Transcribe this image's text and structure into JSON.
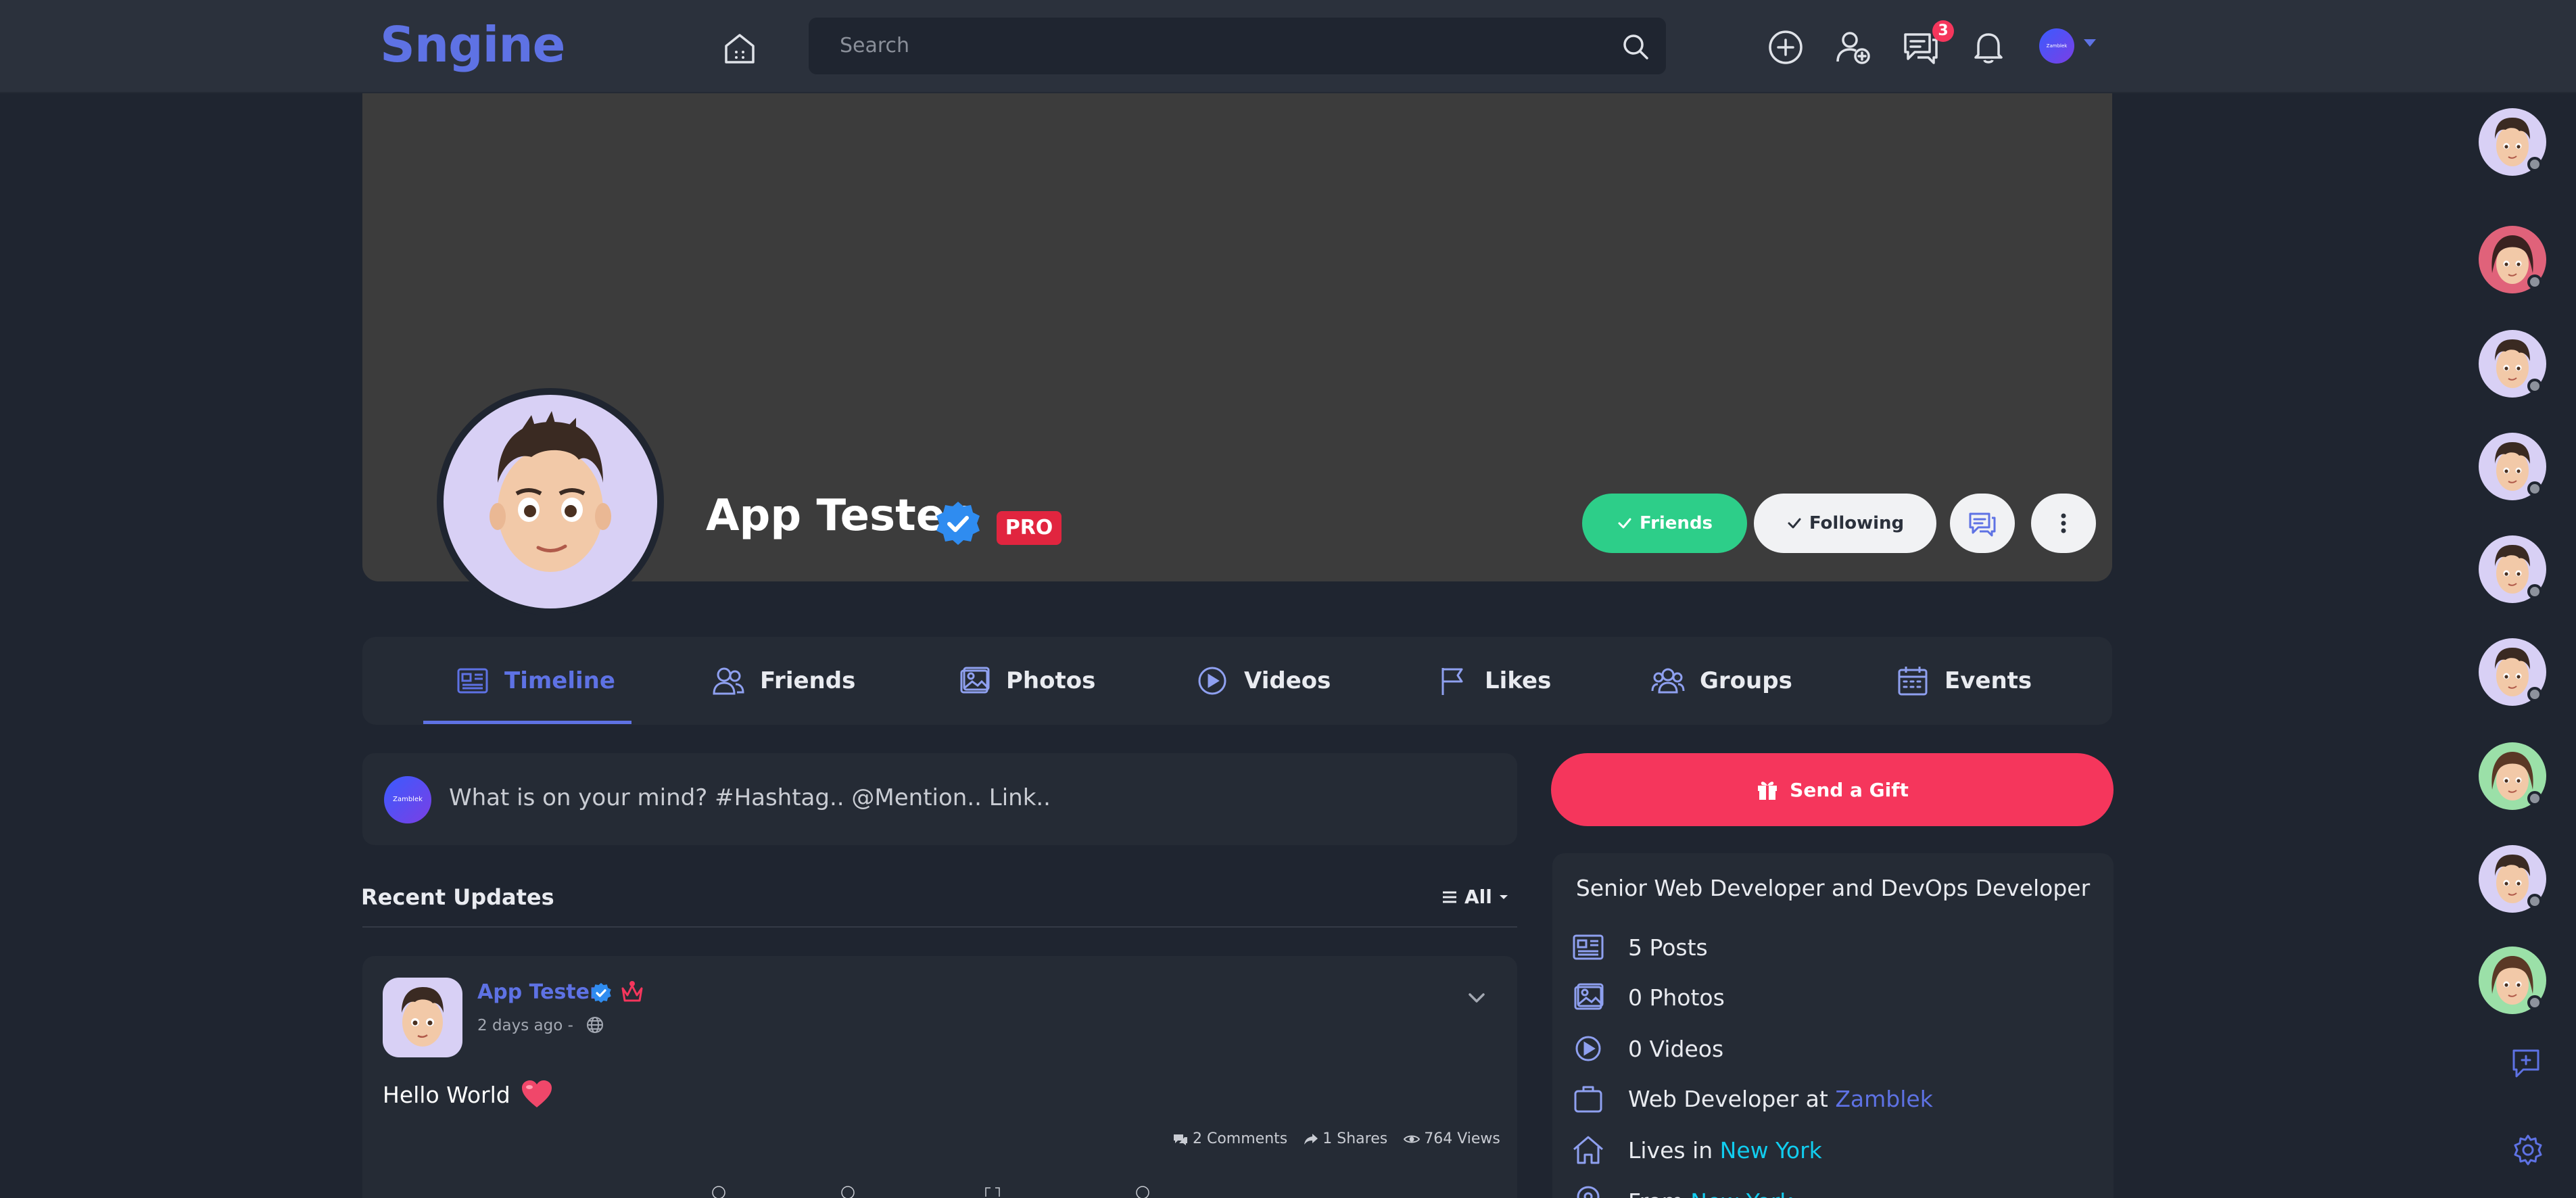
{
  "header": {
    "logo": "Sngine",
    "search_placeholder": "Search",
    "messages_badge": "3",
    "avatar_text": "Zamblek"
  },
  "profile": {
    "name": "App Tester",
    "pro_label": "PRO",
    "friends_btn": "Friends",
    "following_btn": "Following"
  },
  "tabs": [
    {
      "label": "Timeline",
      "icon": "newspaper-icon",
      "active": true
    },
    {
      "label": "Friends",
      "icon": "users-icon"
    },
    {
      "label": "Photos",
      "icon": "image-icon"
    },
    {
      "label": "Videos",
      "icon": "video-icon"
    },
    {
      "label": "Likes",
      "icon": "flag-icon"
    },
    {
      "label": "Groups",
      "icon": "group-icon"
    },
    {
      "label": "Events",
      "icon": "calendar-icon"
    }
  ],
  "composer": {
    "avatar_text": "Zamblek",
    "placeholder": "What is on your mind? #Hashtag.. @Mention.. Link.."
  },
  "recent": {
    "title": "Recent Updates",
    "filter": "All"
  },
  "post": {
    "author": "App Tester",
    "time": "2 days ago -",
    "body": "Hello World",
    "comments": "2 Comments",
    "shares": "1 Shares",
    "views": "764 Views"
  },
  "sidebar": {
    "gift_btn": "Send a Gift",
    "headline": "Senior Web Developer and DevOps Developer",
    "posts": "5 Posts",
    "photos": "0 Photos",
    "videos": "0 Videos",
    "work_prefix": "Web Developer at",
    "work_company": "Zamblek",
    "lives_prefix": "Lives in",
    "lives_city": "New York",
    "from_prefix": "From",
    "from_city": "New York"
  },
  "colors": {
    "accent": "#5e72e4",
    "success": "#2dce89",
    "danger": "#f5365c",
    "link": "#11cdef",
    "background": "#1f2530",
    "card": "#252b35"
  }
}
